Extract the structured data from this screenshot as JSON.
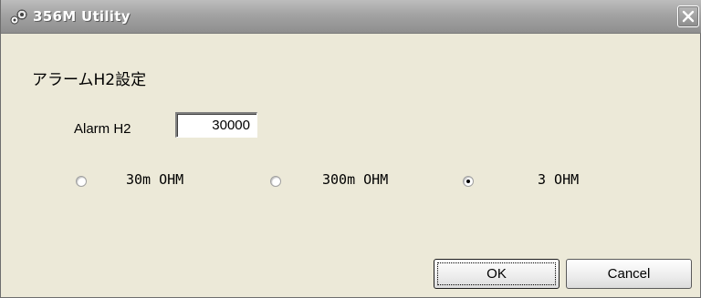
{
  "window": {
    "title": "356M Utility",
    "icon": "app-icon",
    "close_icon": "close-icon"
  },
  "dialog": {
    "heading": "アラームH2設定",
    "alarm": {
      "label": "Alarm H2",
      "value": "30000"
    },
    "range_options": [
      {
        "label": "30m OHM",
        "selected": false
      },
      {
        "label": "300m OHM",
        "selected": false
      },
      {
        "label": "3 OHM",
        "selected": true
      }
    ]
  },
  "buttons": {
    "ok_label": "OK",
    "cancel_label": "Cancel"
  }
}
